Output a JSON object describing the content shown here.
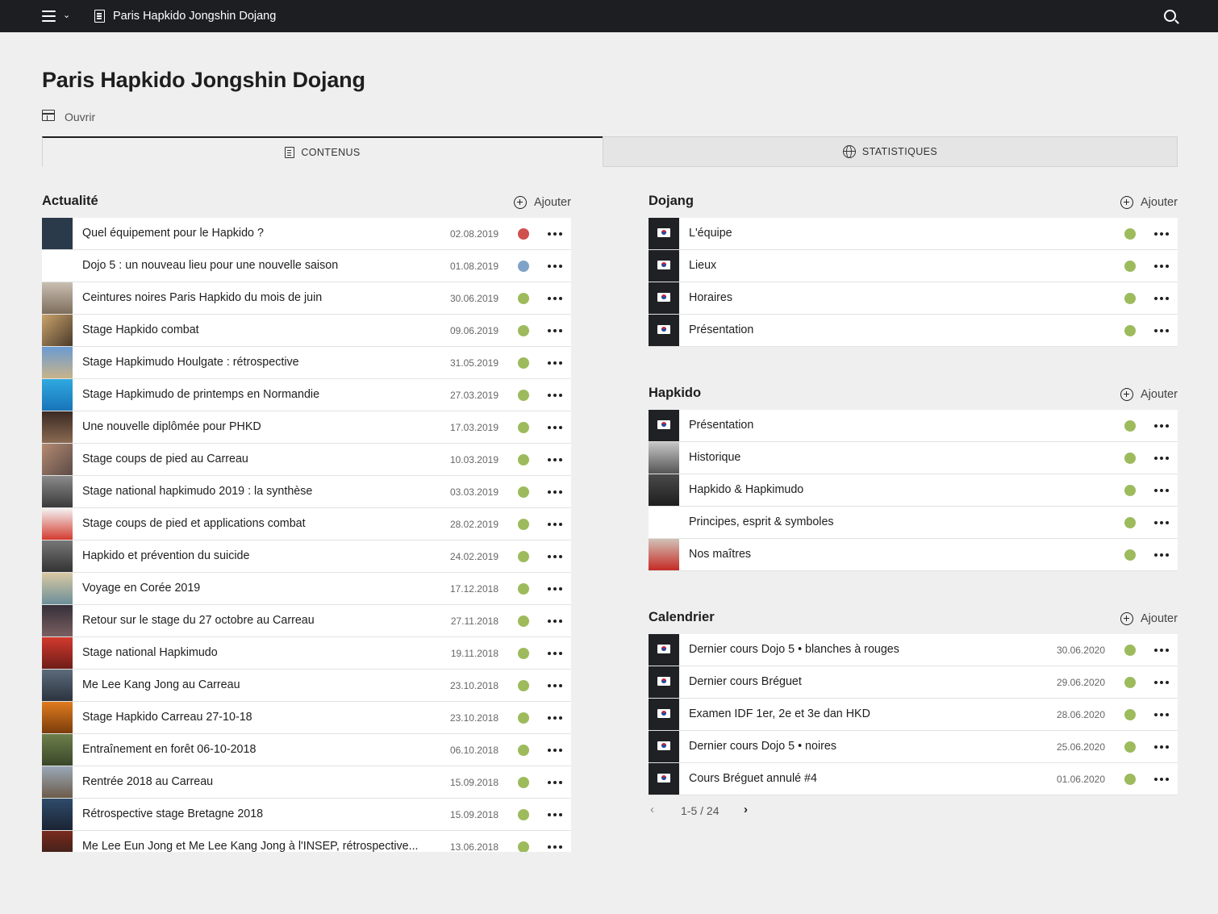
{
  "topbar": {
    "title": "Paris Hapkido Jongshin Dojang"
  },
  "page": {
    "title": "Paris Hapkido Jongshin Dojang",
    "open_label": "Ouvrir"
  },
  "tabs": {
    "contenus": "CONTENUS",
    "statistiques": "STATISTIQUES"
  },
  "colors": {
    "red_dot": "#d0504d",
    "blue_dot": "#7fa2c8",
    "green_dot": "#9dbb5c",
    "topbar_bg": "#1c1e22"
  },
  "actualite": {
    "title": "Actualité",
    "add_label": "Ajouter",
    "items": [
      {
        "label": "Quel équipement pour le Hapkido ?",
        "date": "02.08.2019",
        "status": "red"
      },
      {
        "label": "Dojo 5 : un nouveau lieu pour une nouvelle saison",
        "date": "01.08.2019",
        "status": "blue"
      },
      {
        "label": "Ceintures noires Paris Hapkido du mois de juin",
        "date": "30.06.2019",
        "status": "green"
      },
      {
        "label": "Stage Hapkido combat",
        "date": "09.06.2019",
        "status": "green"
      },
      {
        "label": "Stage Hapkimudo Houlgate : rétrospective",
        "date": "31.05.2019",
        "status": "green"
      },
      {
        "label": "Stage Hapkimudo de printemps en Normandie",
        "date": "27.03.2019",
        "status": "green"
      },
      {
        "label": "Une nouvelle diplômée pour PHKD",
        "date": "17.03.2019",
        "status": "green"
      },
      {
        "label": "Stage coups de pied au Carreau",
        "date": "10.03.2019",
        "status": "green"
      },
      {
        "label": "Stage national hapkimudo 2019 : la synthèse",
        "date": "03.03.2019",
        "status": "green"
      },
      {
        "label": "Stage coups de pied et applications combat",
        "date": "28.02.2019",
        "status": "green"
      },
      {
        "label": "Hapkido et prévention du suicide",
        "date": "24.02.2019",
        "status": "green"
      },
      {
        "label": "Voyage en Corée 2019",
        "date": "17.12.2018",
        "status": "green"
      },
      {
        "label": "Retour sur le stage du 27 octobre au Carreau",
        "date": "27.11.2018",
        "status": "green"
      },
      {
        "label": "Stage national Hapkimudo",
        "date": "19.11.2018",
        "status": "green"
      },
      {
        "label": "Me Lee Kang Jong au Carreau",
        "date": "23.10.2018",
        "status": "green"
      },
      {
        "label": "Stage Hapkido Carreau 27-10-18",
        "date": "23.10.2018",
        "status": "green"
      },
      {
        "label": "Entraînement en forêt 06-10-2018",
        "date": "06.10.2018",
        "status": "green"
      },
      {
        "label": "Rentrée 2018 au Carreau",
        "date": "15.09.2018",
        "status": "green"
      },
      {
        "label": "Rétrospective stage Bretagne 2018",
        "date": "15.09.2018",
        "status": "green"
      },
      {
        "label": "Me Lee Eun Jong et Me Lee Kang Jong à l'INSEP, rétrospective...",
        "date": "13.06.2018",
        "status": "green"
      }
    ]
  },
  "dojang": {
    "title": "Dojang",
    "add_label": "Ajouter",
    "items": [
      {
        "label": "L'équipe",
        "status": "green"
      },
      {
        "label": "Lieux",
        "status": "green"
      },
      {
        "label": "Horaires",
        "status": "green"
      },
      {
        "label": "Présentation",
        "status": "green"
      }
    ]
  },
  "hapkido": {
    "title": "Hapkido",
    "add_label": "Ajouter",
    "items": [
      {
        "label": "Présentation",
        "status": "green"
      },
      {
        "label": "Historique",
        "status": "green"
      },
      {
        "label": "Hapkido & Hapkimudo",
        "status": "green"
      },
      {
        "label": "Principes, esprit & symboles",
        "status": "green"
      },
      {
        "label": "Nos maîtres",
        "status": "green"
      }
    ]
  },
  "calendrier": {
    "title": "Calendrier",
    "add_label": "Ajouter",
    "items": [
      {
        "label": "Dernier cours Dojo 5 • blanches à rouges",
        "date": "30.06.2020",
        "status": "green"
      },
      {
        "label": "Dernier cours Bréguet",
        "date": "29.06.2020",
        "status": "green"
      },
      {
        "label": "Examen IDF 1er, 2e et 3e dan HKD",
        "date": "28.06.2020",
        "status": "green"
      },
      {
        "label": "Dernier cours Dojo 5 • noires",
        "date": "25.06.2020",
        "status": "green"
      },
      {
        "label": "Cours Bréguet annulé #4",
        "date": "01.06.2020",
        "status": "green"
      }
    ],
    "pagination": "1-5 / 24"
  }
}
